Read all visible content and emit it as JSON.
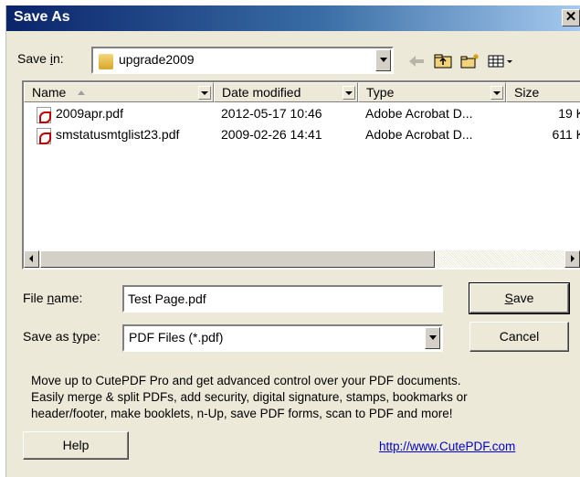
{
  "window": {
    "title": "Save As",
    "close_glyph": "✕"
  },
  "save_in": {
    "label_pre": "Save ",
    "label_accel": "i",
    "label_post": "n:",
    "value": "upgrade2009",
    "icon": "folder-icon"
  },
  "toolbar": {
    "back_icon": "back-arrow-icon",
    "up_icon": "up-folder-icon",
    "new_folder_icon": "new-folder-icon",
    "view_icon": "view-menu-icon"
  },
  "columns": [
    "Name",
    "Date modified",
    "Type",
    "Size"
  ],
  "files": [
    {
      "name": "2009apr.pdf",
      "date": "2012-05-17 10:46",
      "type": "Adobe Acrobat D...",
      "size": "19 K"
    },
    {
      "name": "smstatusmtglist23.pdf",
      "date": "2009-02-26 14:41",
      "type": "Adobe Acrobat D...",
      "size": "611 K"
    }
  ],
  "file_name": {
    "label_pre": "File ",
    "label_accel": "n",
    "label_post": "ame:",
    "value": "Test Page.pdf"
  },
  "save_as_type": {
    "label_pre": "Save as ",
    "label_accel": "t",
    "label_post": "ype:",
    "value": "PDF Files (*.pdf)"
  },
  "buttons": {
    "save_accel": "S",
    "save_rest": "ave",
    "cancel": "Cancel",
    "help": "Help"
  },
  "promo": [
    "Move up to CutePDF Pro and get advanced control over your PDF documents.",
    "Easily merge & split PDFs, add security, digital signature, stamps, bookmarks or",
    "header/footer, make booklets, n-Up, save PDF forms, scan to PDF and more!"
  ],
  "link": "http://www.CutePDF.com"
}
